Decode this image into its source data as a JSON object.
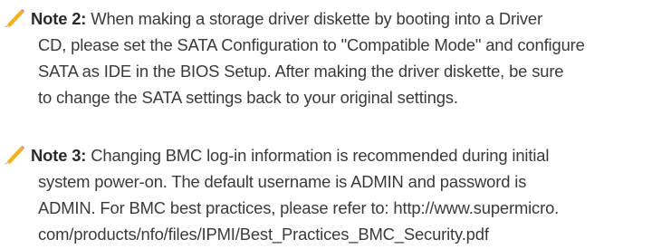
{
  "notes": [
    {
      "icon": "pencil-icon",
      "label": "Note 2:",
      "line1": " When making a storage driver diskette by booting into a Driver",
      "line2": "CD, please set the SATA Configuration to \"Compatible Mode\" and configure",
      "line3": "SATA as IDE in the BIOS Setup. After making the driver diskette, be sure",
      "line4": "to change the SATA settings back to your original settings."
    },
    {
      "icon": "pencil-icon",
      "label": "Note 3:",
      "line1": " Changing BMC log-in information is recommended during initial",
      "line2": "system power-on. The default username is ADMIN and password is",
      "line3": "ADMIN.  For BMC best practices, please refer to: http://www.supermicro.",
      "line4": "com/products/nfo/files/IPMI/Best_Practices_BMC_Security.pdf"
    }
  ],
  "colors": {
    "text": "#3a3a3a",
    "pencil_body": "#f2b21b",
    "pencil_tip": "#e8d2a8"
  }
}
